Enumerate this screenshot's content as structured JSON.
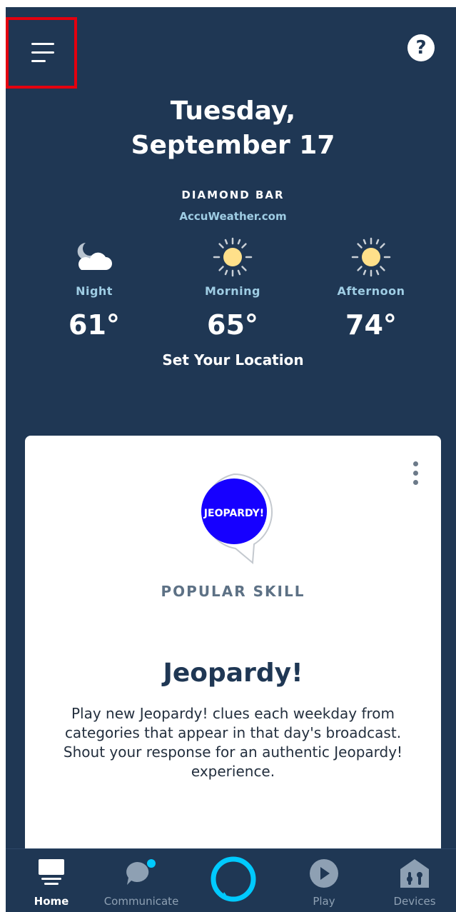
{
  "header": {
    "date_line1": "Tuesday,",
    "date_line2": "September 17"
  },
  "weather": {
    "location": "DIAMOND BAR",
    "provider": "AccuWeather.com",
    "forecast": [
      {
        "period": "Night",
        "temp": "61°",
        "icon": "moon-cloud-icon"
      },
      {
        "period": "Morning",
        "temp": "65°",
        "icon": "sun-icon"
      },
      {
        "period": "Afternoon",
        "temp": "74°",
        "icon": "sun-icon"
      }
    ],
    "set_location": "Set Your Location"
  },
  "card": {
    "logo_text": "JEOPARDY!",
    "tag": "POPULAR SKILL",
    "title": "Jeopardy!",
    "description": "Play new Jeopardy! clues each weekday from categories that appear in that day's broadcast. Shout your response for an authentic Jeopardy! experience."
  },
  "nav": {
    "home": "Home",
    "communicate": "Communicate",
    "play": "Play",
    "devices": "Devices"
  },
  "colors": {
    "background": "#1f3754",
    "accent": "#00caff",
    "highlight": "#e3000f",
    "logo_blue": "#1600ff"
  }
}
